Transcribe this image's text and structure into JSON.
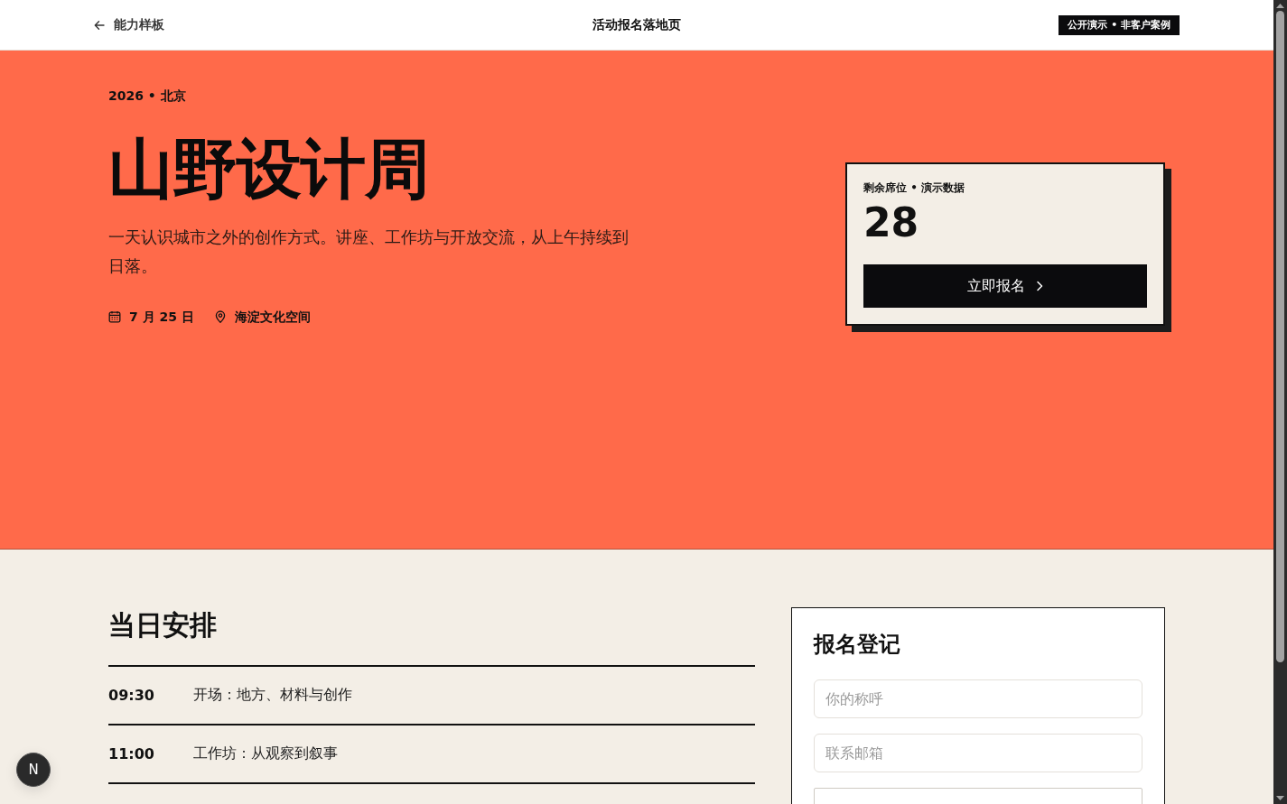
{
  "header": {
    "back_link": "能力样板",
    "title": "活动报名落地页",
    "badge": "公开演示 • 非客户案例"
  },
  "hero": {
    "eyebrow": "2026 • 北京",
    "title": "山野设计周",
    "description": "一天认识城市之外的创作方式。讲座、工作坊与开放交流，从上午持续到日落。",
    "meta": [
      {
        "kind": "date",
        "text": "7 月 25 日"
      },
      {
        "kind": "location",
        "text": "海淀文化空间"
      }
    ]
  },
  "seats_card": {
    "label": "剩余席位 • 演示数据",
    "count": "28",
    "button": "立即报名"
  },
  "schedule": {
    "title": "当日安排",
    "items": [
      {
        "time": "09:30",
        "title": "开场：地方、材料与创作"
      },
      {
        "time": "11:00",
        "title": "工作坊：从观察到叙事"
      }
    ]
  },
  "signup_form": {
    "title": "报名登记",
    "fields": [
      {
        "kind": "input",
        "placeholder": "你的称呼"
      },
      {
        "kind": "input",
        "placeholder": "联系邮箱"
      },
      {
        "kind": "select"
      }
    ]
  },
  "dev_indicator": {
    "label": "N"
  }
}
